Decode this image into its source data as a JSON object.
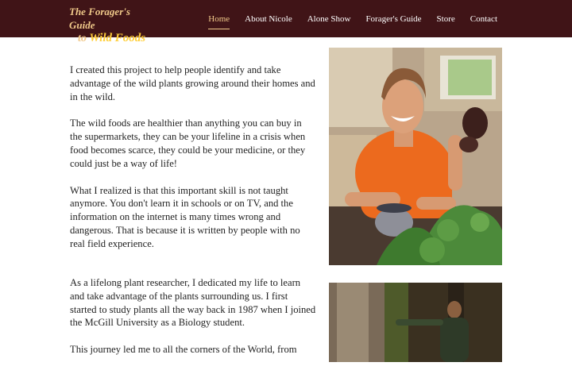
{
  "header": {
    "logo": {
      "line1": "The Forager's Guide",
      "line2_prefix": "to ",
      "line2_emph": "Wild Foods"
    },
    "nav": [
      {
        "label": "Home",
        "active": true
      },
      {
        "label": "About Nicole",
        "active": false
      },
      {
        "label": "Alone Show",
        "active": false
      },
      {
        "label": "Forager's Guide",
        "active": false
      },
      {
        "label": "Store",
        "active": false
      },
      {
        "label": "Contact",
        "active": false
      }
    ]
  },
  "section1": {
    "paragraphs": [
      "I created this project to help people identify and take advantage of the wild plants growing around their homes and in the wild.",
      "The wild foods are healthier than anything you can buy in the supermarkets, they can be your lifeline in a crisis when food becomes scarce, they could be your medicine, or they could just be a way of life!",
      "What I realized is that this important skill is not taught anymore. You don't learn it in schools or on TV, and the information on the internet is many times wrong and dangerous. That is because it is written by people with no real field experience."
    ]
  },
  "section2": {
    "paragraphs": [
      "As a lifelong plant researcher, I dedicated my life to learn and take advantage of the plants surrounding us. I first started to study plants all the way back in 1987 when I joined the McGill University as a Biology student.",
      "This journey led me to all the corners of the World, from"
    ]
  },
  "colors": {
    "header_bg": "#401417",
    "logo_gold": "#f0c98a",
    "nav_active": "#f0c98a",
    "body_text": "#222222"
  }
}
